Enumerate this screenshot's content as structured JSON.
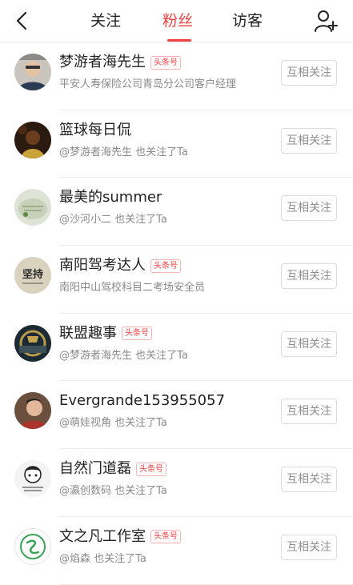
{
  "header": {
    "tabs": [
      {
        "label": "关注"
      },
      {
        "label": "粉丝"
      },
      {
        "label": "访客"
      }
    ]
  },
  "followers": [
    {
      "name": "梦游者海先生",
      "badge": "头条号",
      "sub": "平安人寿保险公司青岛分公司客户经理",
      "button": "互相关注"
    },
    {
      "name": "篮球每日侃",
      "badge": "",
      "sub": "@梦游者海先生 也关注了Ta",
      "button": "互相关注"
    },
    {
      "name": "最美的summer",
      "badge": "",
      "sub": "@沙河小二 也关注了Ta",
      "button": "互相关注"
    },
    {
      "name": "南阳驾考达人",
      "badge": "头条号",
      "sub": "南阳中山驾校科目二考场安全员",
      "button": "互相关注",
      "avatar_text": "坚持"
    },
    {
      "name": "联盟趣事",
      "badge": "头条号",
      "sub": "@梦游者海先生 也关注了Ta",
      "button": "互相关注"
    },
    {
      "name": "Evergrande153955057",
      "badge": "",
      "sub": "@萌娃视角 也关注了Ta",
      "button": "互相关注"
    },
    {
      "name": "自然门道磊",
      "badge": "头条号",
      "sub": "@瀛创数码 也关注了Ta",
      "button": "互相关注"
    },
    {
      "name": "文之凡工作室",
      "badge": "头条号",
      "sub": "@焰森 也关注了Ta",
      "button": "互相关注"
    }
  ]
}
